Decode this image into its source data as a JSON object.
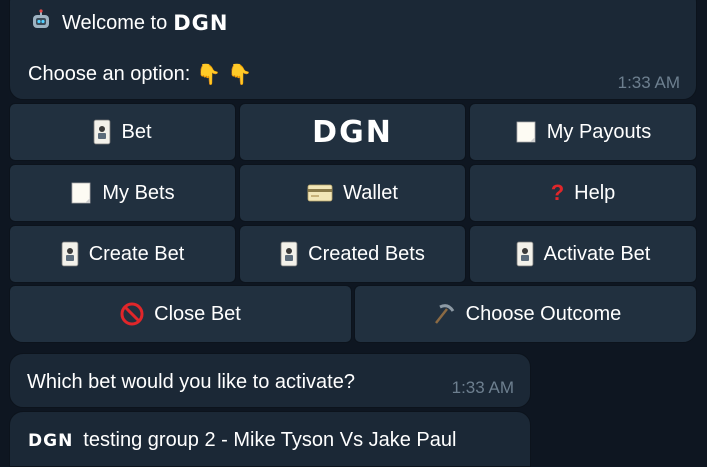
{
  "welcome": {
    "text": "Welcome to",
    "brand": "DGN",
    "prompt": "Choose an option:",
    "time": "1:33 AM",
    "icons": [
      "robot-icon",
      "pointing-down-hand-icon",
      "pointing-down-hand-icon"
    ]
  },
  "keyboard": {
    "row1": [
      {
        "label": "Bet",
        "icon": "playing-card-icon"
      },
      {
        "label": "DGN",
        "icon": "brand-logo"
      },
      {
        "label": "My Payouts",
        "icon": "memo-icon"
      }
    ],
    "row2": [
      {
        "label": "My Bets",
        "icon": "memo-icon"
      },
      {
        "label": "Wallet",
        "icon": "credit-card-icon"
      },
      {
        "label": "Help",
        "icon": "question-mark-icon"
      }
    ],
    "row3": [
      {
        "label": "Create Bet",
        "icon": "playing-card-icon"
      },
      {
        "label": "Created Bets",
        "icon": "playing-card-icon"
      },
      {
        "label": "Activate Bet",
        "icon": "playing-card-icon"
      }
    ],
    "row4": [
      {
        "label": "Close Bet",
        "icon": "no-entry-icon"
      },
      {
        "label": "Choose Outcome",
        "icon": "pick-icon"
      }
    ]
  },
  "question": {
    "text": "Which bet would you like to activate?",
    "time": "1:33 AM"
  },
  "bet_option": {
    "brand": "DGN",
    "label": "testing group 2 - Mike Tyson Vs Jake Paul"
  },
  "colors": {
    "background": "#0e1621",
    "bubble": "#1b2836",
    "button": "#21303f",
    "timestamp": "#6d7f8f",
    "question_mark": "#e0262a"
  }
}
